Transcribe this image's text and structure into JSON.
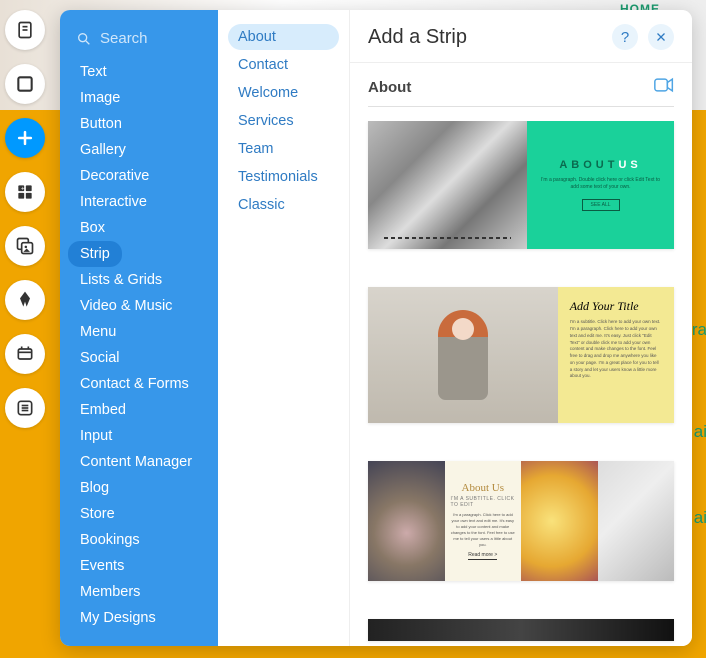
{
  "background": {
    "nav_fragment": "HOME",
    "side_fragments": [
      "ra",
      "ai",
      "ai"
    ]
  },
  "toolbar_icons": [
    "page-icon",
    "frame-icon",
    "add-icon",
    "apps-icon",
    "media-icon",
    "pen-icon",
    "data-icon",
    "list-icon"
  ],
  "search": {
    "placeholder": "Search"
  },
  "categories": [
    {
      "label": "Text"
    },
    {
      "label": "Image"
    },
    {
      "label": "Button"
    },
    {
      "label": "Gallery"
    },
    {
      "label": "Decorative"
    },
    {
      "label": "Interactive"
    },
    {
      "label": "Box"
    },
    {
      "label": "Strip",
      "selected": true
    },
    {
      "label": "Lists & Grids"
    },
    {
      "label": "Video & Music"
    },
    {
      "label": "Menu"
    },
    {
      "label": "Social"
    },
    {
      "label": "Contact & Forms"
    },
    {
      "label": "Embed"
    },
    {
      "label": "Input"
    },
    {
      "label": "Content Manager"
    },
    {
      "label": "Blog"
    },
    {
      "label": "Store"
    },
    {
      "label": "Bookings"
    },
    {
      "label": "Events"
    },
    {
      "label": "Members"
    },
    {
      "label": "My Designs"
    }
  ],
  "subcategories": [
    {
      "label": "About",
      "selected": true
    },
    {
      "label": "Contact"
    },
    {
      "label": "Welcome"
    },
    {
      "label": "Services"
    },
    {
      "label": "Team"
    },
    {
      "label": "Testimonials"
    },
    {
      "label": "Classic"
    }
  ],
  "panel": {
    "title": "Add a Strip",
    "section_title": "About"
  },
  "templates": {
    "t1": {
      "title_a": "ABOUT",
      "title_b": "US",
      "subtitle": "I'm a paragraph. Double click here or click Edit Text to add some text of your own.",
      "button": "SEE ALL"
    },
    "t2": {
      "title": "Add Your Title",
      "body": "I'm a subtitle. Click here to add your own text. I'm a paragraph. Click here to add your own text and edit me. It's easy. Just click \"Edit Text\" or double click me to add your own content and make changes to the font. Feel free to drag and drop me anywhere you like on your page. I'm a great place for you to tell a story and let your users know a little more about you."
    },
    "t3": {
      "title": "About Us",
      "subtitle": "I'M A SUBTITLE. CLICK TO EDIT",
      "body": "I'm a paragraph. Click here to add your own text and edit me. It's easy to add your content and make changes to the font. Feel free to use me to tell your users a little about you.",
      "button": "Read more >"
    }
  }
}
